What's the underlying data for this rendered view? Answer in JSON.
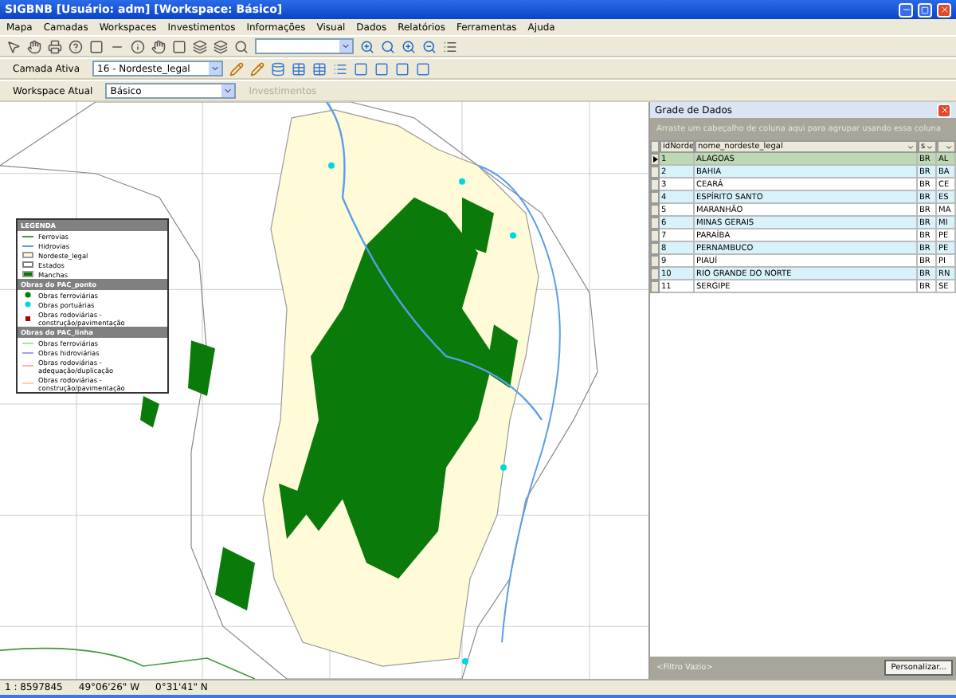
{
  "window": {
    "title": "SIGBNB [Usuário: adm] [Workspace: Básico]"
  },
  "menu": [
    "Mapa",
    "Camadas",
    "Workspaces",
    "Investimentos",
    "Informações",
    "Visual",
    "Dados",
    "Relatórios",
    "Ferramentas",
    "Ajuda"
  ],
  "toolbar": {
    "layer_label": "Camada Ativa",
    "layer_value": "16 - Nordeste_legal",
    "workspace_label": "Workspace Atual",
    "workspace_value": "Básico",
    "investments_button": {
      "label": "Investimentos",
      "disabled": true
    }
  },
  "legend": {
    "title": "LEGENDA",
    "sections": [
      {
        "items": [
          {
            "kind": "line",
            "label": "Ferrovias",
            "color": "#3c9a3c"
          },
          {
            "kind": "line",
            "label": "Hidrovias",
            "color": "#5a9ee8"
          },
          {
            "kind": "fill",
            "label": "Nordeste_legal",
            "color": "#fffbd8"
          },
          {
            "kind": "outline",
            "label": "Estados",
            "color": "#808080"
          },
          {
            "kind": "fill",
            "label": "Manchas",
            "color": "#007a00"
          }
        ]
      },
      {
        "title": "Obras do PAC_ponto",
        "items": [
          {
            "kind": "dot",
            "label": "Obras ferroviárias",
            "color": "#008000"
          },
          {
            "kind": "dot",
            "label": "Obras portuárias",
            "color": "#00d8e0"
          },
          {
            "kind": "square",
            "label": "Obras rodoviárias - construção/pavimentação",
            "color": "#b00000"
          }
        ]
      },
      {
        "title": "Obras do PAC_linha",
        "items": [
          {
            "kind": "line",
            "label": "Obras ferroviárias",
            "color": "#a0e8a0"
          },
          {
            "kind": "line",
            "label": "Obras hidroviárias",
            "color": "#a0a0ff"
          },
          {
            "kind": "line",
            "label": "Obras rodoviárias - adequação/duplicação",
            "color": "#ffb0b0"
          },
          {
            "kind": "line",
            "label": "Obras rodoviárias - construção/pavimentação",
            "color": "#ffd0a0"
          }
        ]
      }
    ]
  },
  "grid": {
    "title": "Grade de Dados",
    "group_hint": "Arraste um cabeçalho de coluna aqui para agrupar usando essa coluna",
    "columns": [
      "idNorde",
      "nome_nordeste_legal",
      "s",
      ""
    ],
    "rows": [
      {
        "cells": [
          "1",
          "ALAGOAS",
          "BR",
          "AL"
        ],
        "selected": true
      },
      {
        "cells": [
          "2",
          "BAHIA",
          "BR",
          "BA"
        ],
        "selected": false
      },
      {
        "cells": [
          "3",
          "CEARÁ",
          "BR",
          "CE"
        ],
        "selected": false
      },
      {
        "cells": [
          "4",
          "ESPÍRITO SANTO",
          "BR",
          "ES"
        ],
        "selected": false
      },
      {
        "cells": [
          "5",
          "MARANHÃO",
          "BR",
          "MA"
        ],
        "selected": false
      },
      {
        "cells": [
          "6",
          "MINAS GERAIS",
          "BR",
          "MI"
        ],
        "selected": false
      },
      {
        "cells": [
          "7",
          "PARAÍBA",
          "BR",
          "PE"
        ],
        "selected": false
      },
      {
        "cells": [
          "8",
          "PERNAMBUCO",
          "BR",
          "PE"
        ],
        "selected": false
      },
      {
        "cells": [
          "9",
          "PIAUÍ",
          "BR",
          "PI"
        ],
        "selected": false
      },
      {
        "cells": [
          "10",
          "RIO GRANDE DO NORTE",
          "BR",
          "RN"
        ],
        "selected": false
      },
      {
        "cells": [
          "11",
          "SERGIPE",
          "BR",
          "SE"
        ],
        "selected": false
      }
    ],
    "filter": "<Filtro Vazio>",
    "customize_button": "Personalizar..."
  },
  "status_bar": [
    "1 : 8597845",
    "49°06'26\" W",
    "0°31'41\" N"
  ]
}
